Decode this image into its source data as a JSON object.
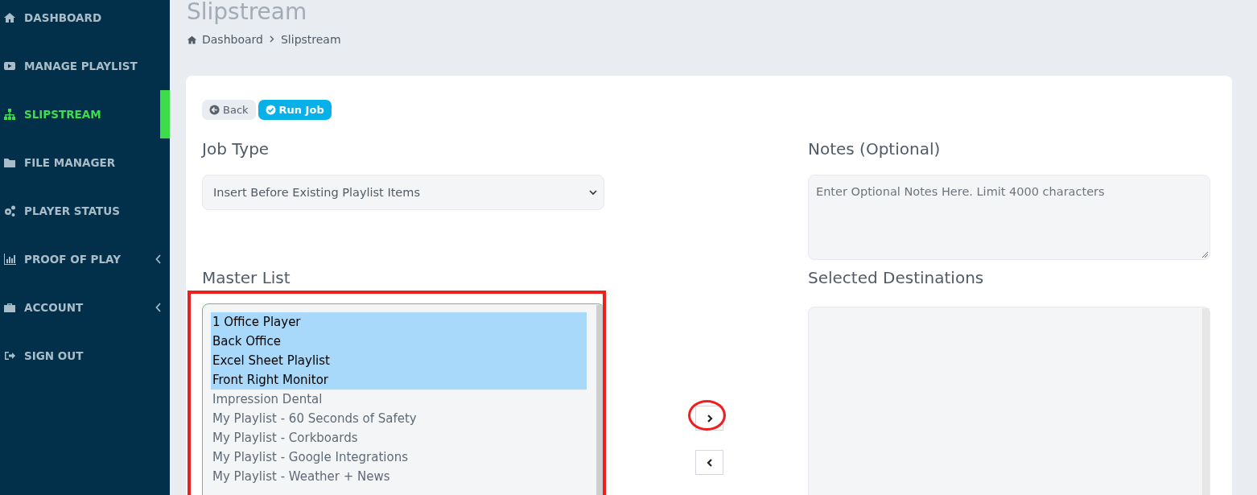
{
  "sidebar": {
    "items": [
      {
        "label": "DASHBOARD",
        "kind": "home",
        "selected": false,
        "expandable": false
      },
      {
        "label": "MANAGE PLAYLIST",
        "kind": "play",
        "selected": false,
        "expandable": false
      },
      {
        "label": "SLIPSTREAM",
        "kind": "sitemap",
        "selected": true,
        "expandable": false
      },
      {
        "label": "FILE MANAGER",
        "kind": "folder",
        "selected": false,
        "expandable": false
      },
      {
        "label": "PLAYER STATUS",
        "kind": "gears",
        "selected": false,
        "expandable": false
      },
      {
        "label": "PROOF OF PLAY",
        "kind": "chart",
        "selected": false,
        "expandable": true
      },
      {
        "label": "ACCOUNT",
        "kind": "briefcase",
        "selected": false,
        "expandable": true
      },
      {
        "label": "SIGN OUT",
        "kind": "signout",
        "selected": false,
        "expandable": false
      }
    ]
  },
  "page_title": "Slipstream",
  "breadcrumb": [
    {
      "label": "Dashboard",
      "kind": "home"
    },
    {
      "label": "Slipstream",
      "kind": "current"
    }
  ],
  "actions": [
    {
      "label": "Back",
      "kind": "back"
    },
    {
      "label": "Run Job",
      "kind": "primary"
    }
  ],
  "job_type": {
    "label": "Job Type",
    "value": "Insert Before Existing Playlist Items"
  },
  "notes": {
    "label": "Notes (Optional)",
    "placeholder": "Enter Optional Notes Here. Limit 4000 characters"
  },
  "master_list": {
    "label": "Master List",
    "highlighted": true,
    "items": [
      {
        "label": "1 Office Player",
        "selected": true
      },
      {
        "label": "Back Office",
        "selected": true
      },
      {
        "label": "Excel Sheet Playlist",
        "selected": true
      },
      {
        "label": "Front Right Monitor",
        "selected": true
      },
      {
        "label": "Impression Dental",
        "selected": false
      },
      {
        "label": "My Playlist - 60 Seconds of Safety",
        "selected": false
      },
      {
        "label": "My Playlist - Corkboards",
        "selected": false
      },
      {
        "label": "My Playlist - Google Integrations",
        "selected": false
      },
      {
        "label": "My Playlist - Weather + News",
        "selected": false
      }
    ]
  },
  "move_buttons": [
    {
      "kind": "right",
      "circled": true
    },
    {
      "kind": "left",
      "circled": false
    }
  ],
  "selected_destinations": {
    "label": "Selected Destinations"
  }
}
